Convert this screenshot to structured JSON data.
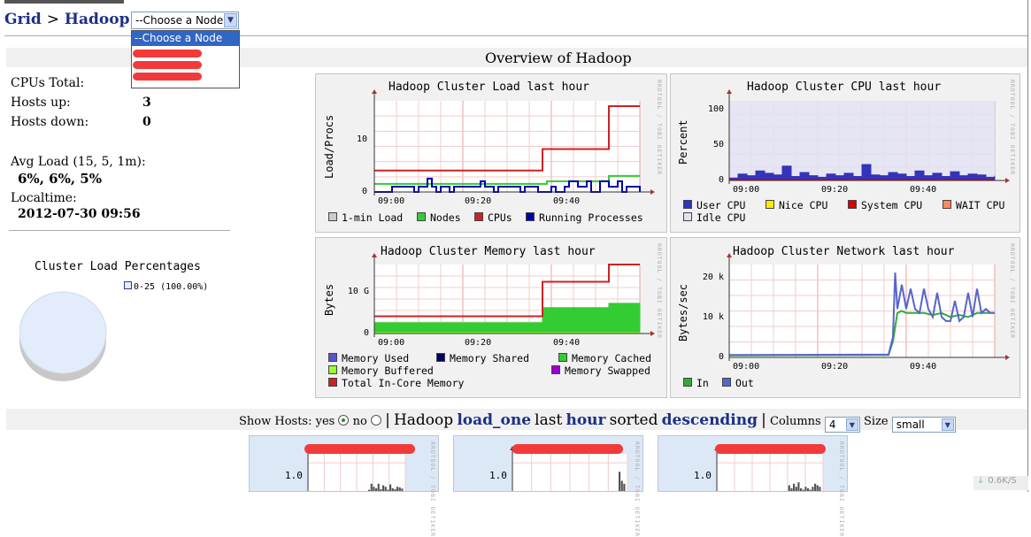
{
  "breadcrumb": {
    "grid": "Grid",
    "sep1": ">",
    "hadoop": "Hadoop",
    "sep2": ">"
  },
  "node_select": {
    "selected": "--Choose a Node",
    "options_visible": [
      "--Choose a Node"
    ]
  },
  "overview": {
    "title": "Overview of Hadoop"
  },
  "stats": {
    "cpus_total_label": "CPUs Total:",
    "hosts_up_label": "Hosts up:",
    "hosts_up_value": "3",
    "hosts_down_label": "Hosts down:",
    "hosts_down_value": "0",
    "avg_load_label": "Avg Load (15, 5, 1m):",
    "avg_load_value": "6%, 6%, 5%",
    "localtime_label": "Localtime:",
    "localtime_value": "2012-07-30 09:56"
  },
  "pie": {
    "title": "Cluster Load Percentages",
    "legend": "0-25 (100.00%)",
    "value_percent": 100,
    "color": "#e3ecfb"
  },
  "rrd_credit": "RRDTOOL / TOBI OETIKER",
  "colors": {
    "link": "#1c2f88",
    "selection": "#3166c2",
    "redaction": "#f23a3a",
    "graph_bg": "#f1f1f1",
    "host_bg": "#dde8f7"
  },
  "chart_data": [
    {
      "type": "line",
      "title": "Hadoop Cluster Load last hour",
      "ylabel": "Load/Procs",
      "x_ticks": [
        "09:00",
        "09:20",
        "09:40"
      ],
      "y_ticks": [
        "10",
        "0"
      ],
      "ylim": [
        0,
        17
      ],
      "series": [
        {
          "name": "1-min Load",
          "color": "#cccccc",
          "x": [
            0,
            60
          ],
          "values": [
            0,
            0
          ]
        },
        {
          "name": "Nodes",
          "color": "#33cc33",
          "x": [
            0,
            38,
            39,
            52,
            53,
            60
          ],
          "values": [
            1.5,
            1.5,
            2,
            2,
            3,
            3
          ]
        },
        {
          "name": "CPUs",
          "color": "#cc2222",
          "x": [
            0,
            37,
            38,
            52,
            53,
            60
          ],
          "values": [
            4,
            4,
            8,
            8,
            16,
            16
          ]
        },
        {
          "name": "Running Processes",
          "color": "#0000aa",
          "x": [
            0,
            3,
            4,
            9,
            10,
            12,
            13,
            14,
            15,
            17,
            18,
            23,
            24,
            25,
            27,
            28,
            30,
            33,
            34,
            37,
            40,
            41,
            43,
            44,
            46,
            48,
            49,
            51,
            53,
            55,
            56,
            57,
            60
          ],
          "values": [
            0,
            0,
            1,
            0,
            1,
            2.5,
            1,
            0,
            1,
            0,
            1,
            1,
            2,
            1,
            0,
            1,
            1,
            0,
            1,
            0,
            1,
            0,
            1,
            2,
            1,
            2,
            0,
            2,
            1,
            2,
            0,
            1,
            0
          ]
        }
      ]
    },
    {
      "type": "area",
      "title": "Hadoop Cluster CPU last hour",
      "ylabel": "Percent",
      "x_ticks": [
        "09:00",
        "09:20",
        "09:40"
      ],
      "y_ticks": [
        "100",
        "50",
        "0"
      ],
      "ylim": [
        0,
        100
      ],
      "series": [
        {
          "name": "User CPU",
          "color": "#3333bb",
          "x": [
            0,
            2,
            4,
            6,
            8,
            10,
            12,
            14,
            16,
            18,
            20,
            22,
            24,
            26,
            28,
            30,
            32,
            34,
            36,
            38,
            40,
            42,
            44,
            46,
            48,
            50,
            52,
            54,
            56,
            58,
            60
          ],
          "values": [
            3,
            8,
            6,
            12,
            9,
            7,
            18,
            5,
            10,
            6,
            4,
            8,
            6,
            9,
            5,
            20,
            7,
            6,
            10,
            8,
            5,
            12,
            6,
            9,
            5,
            11,
            6,
            8,
            7,
            4,
            6
          ]
        },
        {
          "name": "Nice CPU",
          "color": "#ffea00",
          "x": [
            0,
            60
          ],
          "values": [
            0,
            0
          ]
        },
        {
          "name": "System CPU",
          "color": "#dd0000",
          "x": [
            0,
            60
          ],
          "values": [
            1,
            1
          ]
        },
        {
          "name": "WAIT CPU",
          "color": "#ff8a60",
          "x": [
            0,
            60
          ],
          "values": [
            0,
            0
          ]
        },
        {
          "name": "Idle CPU",
          "color": "#e2e2f2",
          "x": [
            0,
            60
          ],
          "values": [
            100,
            100
          ]
        }
      ]
    },
    {
      "type": "area",
      "title": "Hadoop Cluster Memory last hour",
      "ylabel": "Bytes",
      "x_ticks": [
        "09:00",
        "09:20",
        "09:40"
      ],
      "y_ticks": [
        "10 G",
        "0"
      ],
      "ylim": [
        0,
        16
      ],
      "series": [
        {
          "name": "Memory Used",
          "color": "#5555cc",
          "x": [
            0,
            37,
            38,
            52,
            53,
            60
          ],
          "values": [
            1.5,
            1.5,
            2.5,
            2.5,
            4,
            4
          ]
        },
        {
          "name": "Memory Shared",
          "color": "#000066",
          "x": [
            0,
            60
          ],
          "values": [
            0,
            0
          ]
        },
        {
          "name": "Memory Cached",
          "color": "#33cc33",
          "x": [
            0,
            37,
            38,
            52,
            53,
            60
          ],
          "values": [
            2.5,
            2.5,
            6,
            6,
            7,
            7
          ]
        },
        {
          "name": "Memory Buffered",
          "color": "#99ff33",
          "x": [
            0,
            60
          ],
          "values": [
            0.2,
            0.2
          ]
        },
        {
          "name": "Memory Swapped",
          "color": "#9900cc",
          "x": [
            0,
            60
          ],
          "values": [
            0,
            0
          ]
        },
        {
          "name": "Total In-Core Memory",
          "color": "#cc2222",
          "x": [
            0,
            37,
            38,
            52,
            53,
            60
          ],
          "values": [
            4,
            4,
            12,
            12,
            16,
            16
          ]
        }
      ]
    },
    {
      "type": "line",
      "title": "Hadoop Cluster Network last hour",
      "ylabel": "Bytes/sec",
      "x_ticks": [
        "09:00",
        "09:20",
        "09:40"
      ],
      "y_ticks": [
        "20 k",
        "10 k",
        "0"
      ],
      "ylim": [
        0,
        23
      ],
      "series": [
        {
          "name": "In",
          "color": "#33aa33",
          "x": [
            0,
            36,
            37,
            38,
            39,
            40,
            44,
            46,
            48,
            50,
            52,
            54,
            56,
            58,
            60
          ],
          "values": [
            0.5,
            0.6,
            4,
            11,
            11.5,
            11,
            11,
            10.5,
            11,
            10,
            10.5,
            10,
            11,
            11,
            11
          ]
        },
        {
          "name": "Out",
          "color": "#5566cc",
          "x": [
            0,
            36,
            37,
            37.5,
            38,
            39,
            40,
            41,
            42,
            43,
            44,
            45,
            46,
            47,
            48,
            49,
            50,
            51,
            52,
            53,
            54,
            55,
            56,
            57,
            58,
            59,
            60
          ],
          "values": [
            0.6,
            0.7,
            5,
            21,
            12,
            18,
            12,
            17,
            12,
            11,
            17,
            12,
            10,
            16,
            10,
            9,
            9,
            14,
            9,
            10,
            16,
            10,
            17,
            11,
            12,
            11,
            11
          ]
        }
      ]
    },
    {
      "type": "bar",
      "host_index": 0,
      "y_ticks": [
        "1.0"
      ],
      "ylim": [
        0,
        1.3
      ],
      "values": [
        0.1,
        0.3,
        0.2,
        0.15,
        0.3,
        0.12,
        0.25,
        0.2,
        0.1,
        0.28,
        0.15,
        0.12,
        0.2,
        0.18,
        0.14
      ]
    },
    {
      "type": "bar",
      "host_index": 1,
      "y_ticks": [
        "1.0"
      ],
      "ylim": [
        0,
        1.3
      ],
      "values": [
        0.0,
        0.0,
        0.0,
        0.0,
        0.0,
        0.0,
        0.0,
        0.0,
        0.0,
        0.0,
        0.0,
        0.0,
        0.7,
        0.4,
        0.3
      ]
    },
    {
      "type": "bar",
      "host_index": 2,
      "y_ticks": [
        "1.0"
      ],
      "ylim": [
        0,
        1.3
      ],
      "values": [
        0.05,
        0.25,
        0.15,
        0.3,
        0.2,
        0.35,
        0.15,
        0.1,
        0.2,
        0.15,
        0.1,
        0.2,
        0.3,
        0.25,
        0.2
      ]
    }
  ],
  "host_controls": {
    "show_hosts_label": "Show Hosts: yes",
    "no_label": "no",
    "pipe": "|",
    "cluster_name": "Hadoop",
    "metric": "load_one",
    "range": "hour",
    "sorted_label": "sorted",
    "sort_order": "descending",
    "columns_label": "Columns",
    "columns_value": "4",
    "size_label": "Size",
    "size_value": "small"
  },
  "status_bar": {
    "rate": "0.6K/S"
  }
}
